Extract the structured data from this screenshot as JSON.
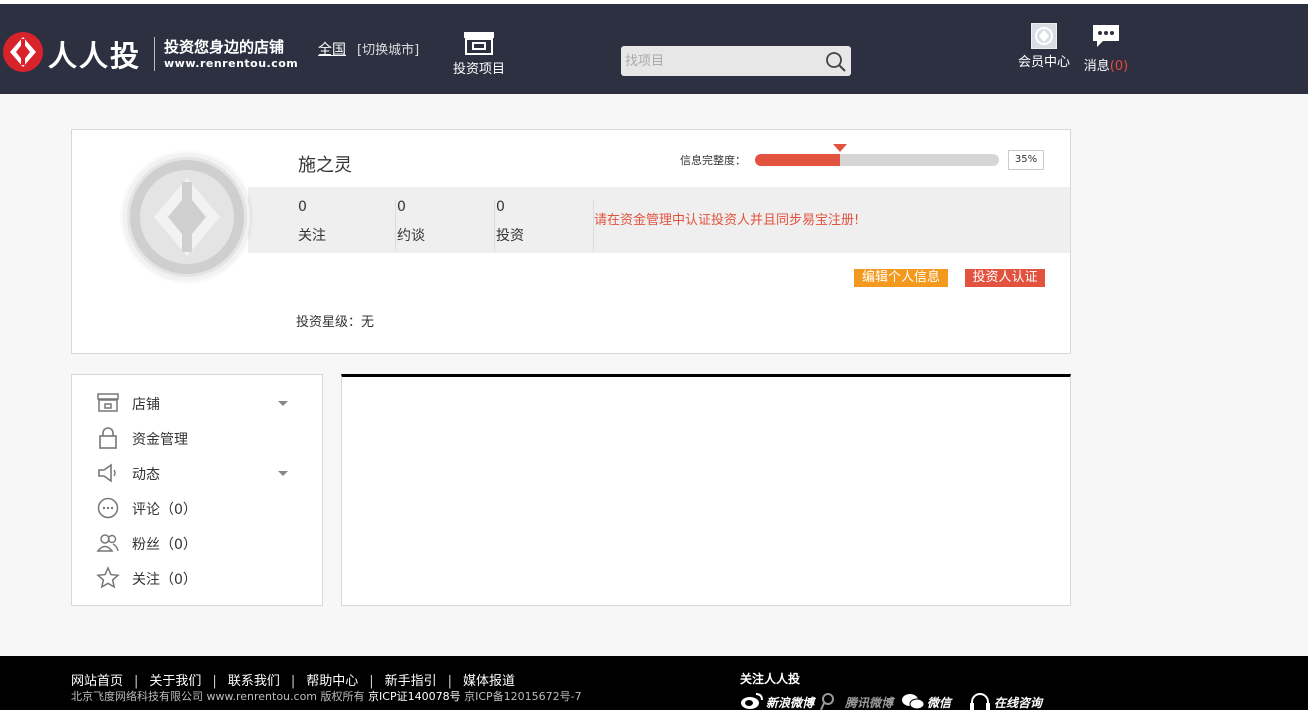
{
  "header": {
    "logo_text": "人人投",
    "slogan": "投资您身边的店铺",
    "url": "www.renrentou.com",
    "city": "全国",
    "city_switch": "[切换城市]",
    "nav_invest_label": "投资项目",
    "search_placeholder": "找项目",
    "member_label": "会员中心",
    "message_label": "消息",
    "message_count": "(0)"
  },
  "profile": {
    "username": "施之灵",
    "completeness_label": "信息完整度：",
    "completeness_percent": 35,
    "completeness_text": "35%",
    "stats": [
      {
        "value": "0",
        "label": "关注"
      },
      {
        "value": "0",
        "label": "约谈"
      },
      {
        "value": "0",
        "label": "投资"
      }
    ],
    "notice": "请在资金管理中认证投资人并且同步易宝注册!",
    "edit_button": "编辑个人信息",
    "verify_button": "投资人认证",
    "star_level": "投资星级：无"
  },
  "sidebar": {
    "items": [
      {
        "label": "店铺",
        "icon": "shop-icon",
        "has_arrow": true
      },
      {
        "label": "资金管理",
        "icon": "lock-icon",
        "has_arrow": false
      },
      {
        "label": "动态",
        "icon": "speaker-icon",
        "has_arrow": true
      },
      {
        "label": "评论（0）",
        "icon": "comment-icon",
        "has_arrow": false
      },
      {
        "label": "粉丝（0）",
        "icon": "fans-icon",
        "has_arrow": false
      },
      {
        "label": "关注（0）",
        "icon": "star-icon",
        "has_arrow": false
      }
    ]
  },
  "footer": {
    "links": [
      "网站首页",
      "关于我们",
      "联系我们",
      "帮助中心",
      "新手指引",
      "媒体报道"
    ],
    "company": "北京飞度网络科技有限公司 www.renrentou.com 版权所有",
    "icp1": "京ICP证140078号",
    "icp2": "京ICP备12015672号-7",
    "follow_title": "关注人人投",
    "social": [
      "新浪微博",
      "腾讯微博",
      "微信",
      "在线咨询"
    ]
  },
  "colors": {
    "header_bg": "#2d3040",
    "accent_red": "#e2533f",
    "accent_orange": "#f39a1e"
  }
}
